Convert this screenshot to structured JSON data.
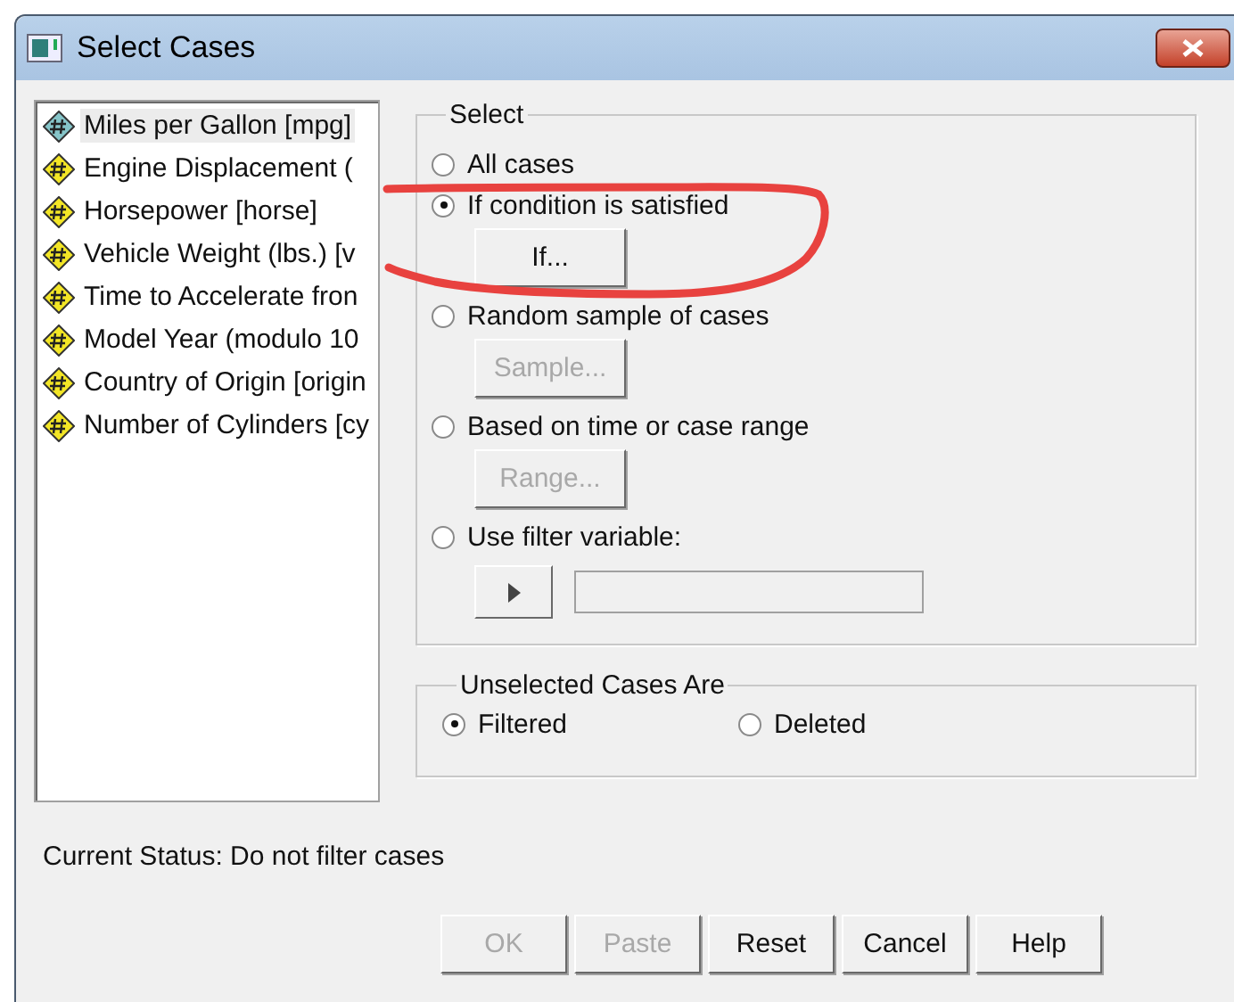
{
  "window": {
    "title": "Select Cases"
  },
  "variables": [
    {
      "label": "Miles per Gallon [mpg]",
      "selected": true,
      "color": "#86c5c9"
    },
    {
      "label": "Engine Displacement (",
      "selected": false,
      "color": "#f3e626"
    },
    {
      "label": "Horsepower [horse]",
      "selected": false,
      "color": "#f3e626"
    },
    {
      "label": "Vehicle Weight (lbs.) [v",
      "selected": false,
      "color": "#f3e626"
    },
    {
      "label": "Time to Accelerate fron",
      "selected": false,
      "color": "#f3e626"
    },
    {
      "label": "Model Year (modulo 10",
      "selected": false,
      "color": "#f3e626"
    },
    {
      "label": "Country of Origin [origin",
      "selected": false,
      "color": "#f3e626"
    },
    {
      "label": "Number of Cylinders [cy",
      "selected": false,
      "color": "#f3e626"
    }
  ],
  "select": {
    "title": "Select",
    "options": [
      {
        "label": "All cases",
        "selected": false
      },
      {
        "label": "If condition is satisfied",
        "selected": true,
        "control": {
          "kind": "button",
          "label": "If...",
          "disabled": false
        }
      },
      {
        "label": "Random sample of cases",
        "selected": false,
        "control": {
          "kind": "button",
          "label": "Sample...",
          "disabled": true
        }
      },
      {
        "label": "Based on time or case range",
        "selected": false,
        "control": {
          "kind": "button",
          "label": "Range...",
          "disabled": true
        }
      },
      {
        "label": "Use filter variable:",
        "selected": false,
        "control": {
          "kind": "picker"
        }
      }
    ]
  },
  "unselected": {
    "title": "Unselected Cases Are",
    "options": [
      {
        "label": "Filtered",
        "selected": true
      },
      {
        "label": "Deleted",
        "selected": false
      }
    ]
  },
  "status": "Current Status: Do not filter cases",
  "buttons": [
    {
      "label": "OK",
      "disabled": true
    },
    {
      "label": "Paste",
      "disabled": true
    },
    {
      "label": "Reset",
      "disabled": false
    },
    {
      "label": "Cancel",
      "disabled": false
    },
    {
      "label": "Help",
      "disabled": false
    }
  ]
}
